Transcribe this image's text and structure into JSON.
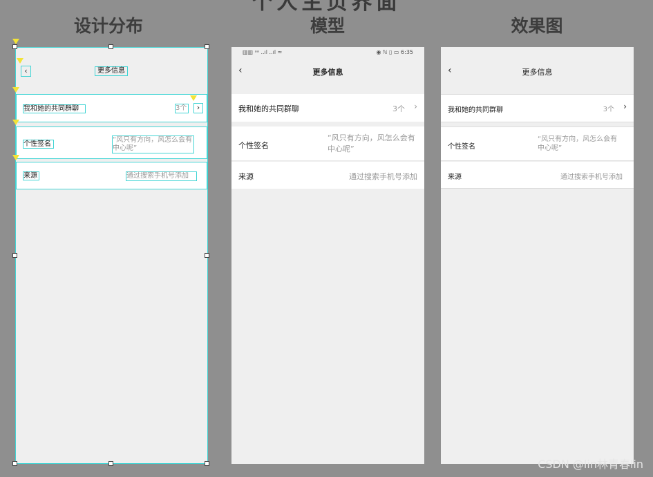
{
  "header_partial": "个人主页界面",
  "columns": {
    "design": "设计分布",
    "model": "模型",
    "result": "效果图"
  },
  "status_bar": {
    "left": "▥▥ ᵃᵃ ..ıl ..ıl ≈",
    "right": "◉ ℕ ▯ ▭ 6:35"
  },
  "page": {
    "back_glyph": "‹",
    "title": "更多信息",
    "rows": {
      "groups_label": "我和她的共同群聊",
      "groups_count": "3个",
      "groups_chevron": "›",
      "signature_label": "个性签名",
      "signature_value": "“风只有方向，风怎么会有中心呢”",
      "source_label": "来源",
      "source_value": "通过搜索手机号添加"
    }
  },
  "watermark": "CSDN @lin林青春lin"
}
